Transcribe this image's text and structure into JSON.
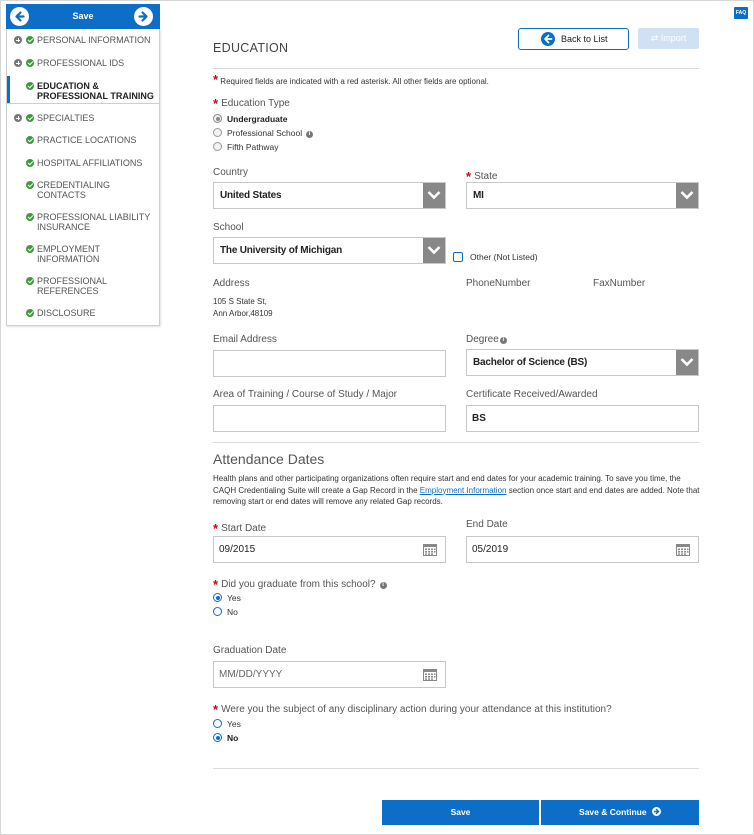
{
  "topbar": {
    "save_label": "Save"
  },
  "faq_label": "FAQ",
  "sidebar": {
    "items": [
      {
        "label": "PERSONAL INFORMATION"
      },
      {
        "label": "PROFESSIONAL IDS"
      },
      {
        "label": "EDUCATION & PROFESSIONAL TRAINING"
      },
      {
        "label": "SPECIALTIES"
      },
      {
        "label": "PRACTICE LOCATIONS"
      },
      {
        "label": "HOSPITAL AFFILIATIONS"
      },
      {
        "label": "CREDENTIALING CONTACTS"
      },
      {
        "label": "PROFESSIONAL LIABILITY INSURANCE"
      },
      {
        "label": "EMPLOYMENT INFORMATION"
      },
      {
        "label": "PROFESSIONAL REFERENCES"
      },
      {
        "label": "DISCLOSURE"
      }
    ]
  },
  "header": {
    "title": "EDUCATION",
    "back_label": "Back to List",
    "import_label": "⇄ Import"
  },
  "form": {
    "required_note": "Required fields are indicated with a red asterisk. All other fields are optional.",
    "education_type": {
      "label": "Education Type",
      "options": [
        "Undergraduate",
        "Professional School",
        "Fifth Pathway"
      ]
    },
    "country": {
      "label": "Country",
      "value": "United States"
    },
    "state": {
      "label": "State",
      "value": "MI"
    },
    "school": {
      "label": "School",
      "value": "The University of Michigan",
      "other_label": "Other (Not Listed)"
    },
    "address": {
      "label": "Address",
      "line1": "105 S State St,",
      "line2": "Ann Arbor,48109"
    },
    "phone": {
      "label": "PhoneNumber"
    },
    "fax": {
      "label": "FaxNumber"
    },
    "email": {
      "label": "Email Address",
      "value": ""
    },
    "degree": {
      "label": "Degree",
      "value": "Bachelor of Science (BS)"
    },
    "area": {
      "label": "Area of Training / Course of Study / Major",
      "value": ""
    },
    "certificate": {
      "label": "Certificate Received/Awarded",
      "value": "BS"
    },
    "attendance": {
      "heading": "Attendance Dates",
      "para_before": "Health plans and other participating organizations often require start and end dates for your academic training. To save you time, the CAQH Credentialing Suite will create a Gap Record in the ",
      "para_link": "Employment Information",
      "para_after": " section once start and end dates are added. Note that removing start or end dates will remove any related Gap records."
    },
    "start_date": {
      "label": "Start Date",
      "value": "09/2015"
    },
    "end_date": {
      "label": "End Date",
      "value": "05/2019"
    },
    "graduated": {
      "label": "Did you graduate from this school?",
      "options": [
        "Yes",
        "No"
      ]
    },
    "graduation_date": {
      "label": "Graduation Date",
      "placeholder": "MM/DD/YYYY"
    },
    "disciplinary": {
      "label": "Were you the subject of any disciplinary action during your attendance at this institution?",
      "options": [
        "Yes",
        "No"
      ]
    }
  },
  "footer": {
    "save_label": "Save",
    "save_continue_label": "Save & Continue"
  },
  "colors": {
    "accent": "#0d6ec8",
    "required": "#d0021b",
    "complete": "#3c9a3c"
  }
}
